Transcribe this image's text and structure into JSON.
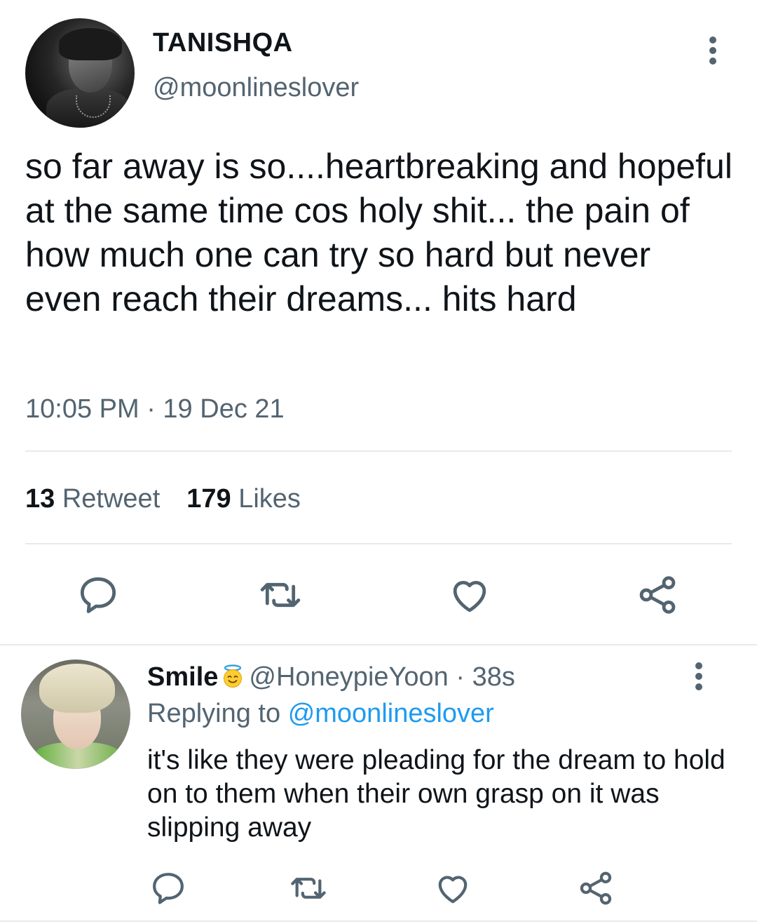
{
  "main_tweet": {
    "display_name": "TANISHQA",
    "handle": "@moonlineslover",
    "text": "so far away is so....heartbreaking and hopeful at the same time cos holy shit... the pain of how much one can try so hard but never even reach their dreams... hits hard",
    "timestamp": "10:05 PM · 19 Dec 21",
    "retweet_count": "13",
    "retweet_label": "Retweet",
    "likes_count": "179",
    "likes_label": "Likes",
    "more_icon": "more-vertical-icon"
  },
  "actions": [
    "reply-icon",
    "retweet-icon",
    "like-icon",
    "share-icon"
  ],
  "reply": {
    "display_name": "Smile",
    "emoji": "smiling-face-with-halo-emoji",
    "handle": "@HoneypieYoon",
    "separator": "·",
    "time": "38s",
    "replying_prefix": "Replying to",
    "replying_to": "@moonlineslover",
    "text": "it's like they were pleading for the dream to hold on to them when their own grasp on it was slipping away"
  },
  "colors": {
    "text_primary": "#0f1419",
    "text_secondary": "#536471",
    "link": "#1d9bf0",
    "divider": "#e7e9ea"
  }
}
